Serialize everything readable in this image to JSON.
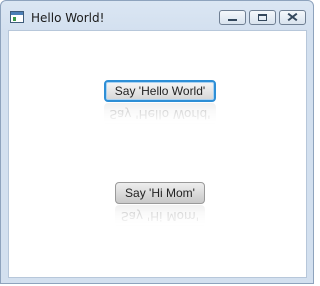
{
  "window": {
    "title": "Hello World!",
    "controls": {
      "minimize": "minimize-icon",
      "maximize": "maximize-icon",
      "close": "close-icon"
    }
  },
  "buttons": {
    "hello_label": "Say 'Hello World'",
    "mom_label": "Say 'Hi Mom'"
  },
  "colors": {
    "focus_ring": "#2e8fd6",
    "titlebar": "#d3e0ef",
    "client_bg": "#ffffff"
  }
}
